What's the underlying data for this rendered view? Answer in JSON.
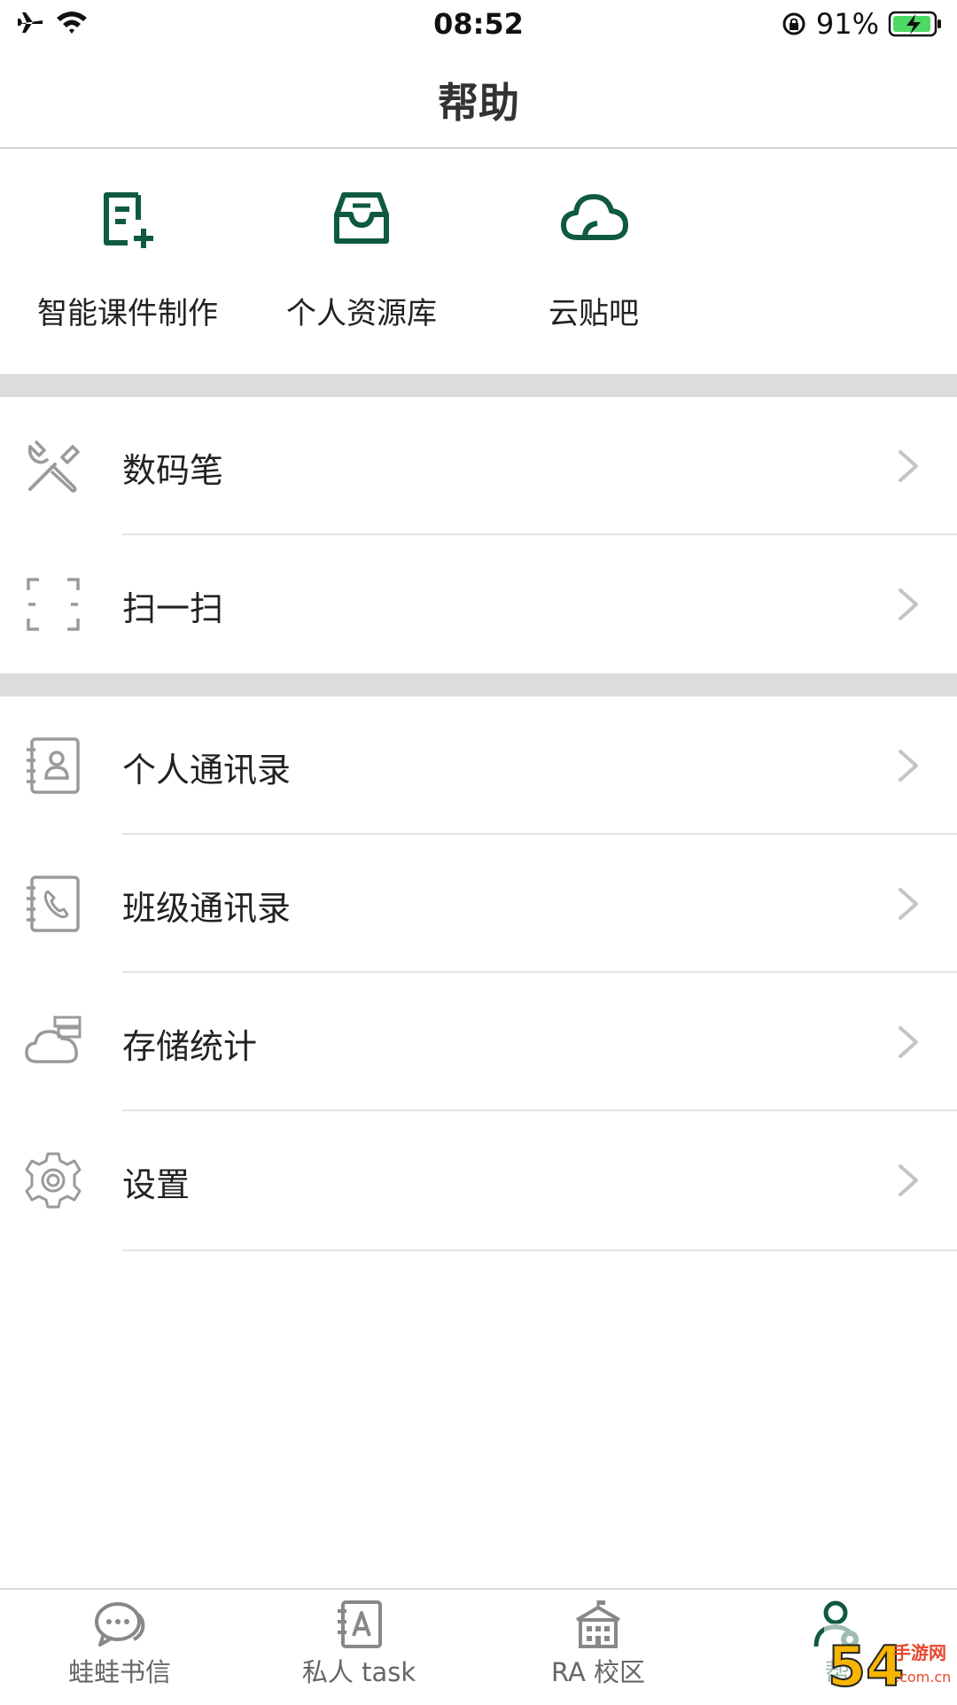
{
  "status_bar": {
    "time": "08:52",
    "battery": "91%"
  },
  "nav": {
    "title": "帮助"
  },
  "quick_actions": [
    {
      "label": "智能课件制作",
      "icon": "document-add-icon"
    },
    {
      "label": "个人资源库",
      "icon": "inbox-icon"
    },
    {
      "label": "云贴吧",
      "icon": "cloud-icon"
    }
  ],
  "list_groups": [
    [
      {
        "label": "数码笔",
        "icon": "tools-icon"
      },
      {
        "label": "扫一扫",
        "icon": "scan-icon"
      }
    ],
    [
      {
        "label": "个人通讯录",
        "icon": "contact-book-icon"
      },
      {
        "label": "班级通讯录",
        "icon": "phone-book-icon"
      },
      {
        "label": "存储统计",
        "icon": "cloud-storage-icon"
      },
      {
        "label": "设置",
        "icon": "gear-icon"
      }
    ]
  ],
  "tabs": [
    {
      "label": "蛙蛙书信",
      "icon": "chat-bubble-icon"
    },
    {
      "label": "私人 task",
      "icon": "notebook-icon"
    },
    {
      "label": "RA 校区",
      "icon": "school-building-icon"
    },
    {
      "label": "帮",
      "icon": "user-settings-icon",
      "active": true
    }
  ],
  "watermark": {
    "text_main": "54",
    "text_site": "手游网",
    "text_domain": ".com.cn"
  },
  "colors": {
    "accent": "#0f5a3e",
    "icon_gray": "#9a9a9a",
    "separator": "#dcdcdc"
  }
}
